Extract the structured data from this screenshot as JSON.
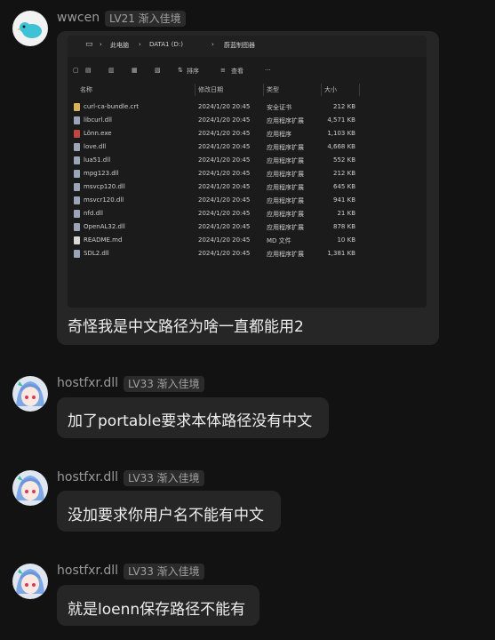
{
  "messages": [
    {
      "user": "wwcen",
      "level": "LV21 渐入佳境",
      "explorer": {
        "breadcrumb": [
          "此电脑",
          "DATA1 (D:)",
          "蔚蓝制图器"
        ],
        "toolbar": {
          "sort": "排序",
          "view": "查看",
          "more": "···"
        },
        "columns": [
          "名称",
          "修改日期",
          "类型",
          "大小"
        ],
        "files": [
          {
            "name": "curl-ca-bundle.crt",
            "date": "2024/1/20 20:45",
            "type": "安全证书",
            "size": "212 KB",
            "icon": "certificate-icon"
          },
          {
            "name": "libcurl.dll",
            "date": "2024/1/20 20:45",
            "type": "应用程序扩展",
            "size": "4,571 KB",
            "icon": "dll-icon"
          },
          {
            "name": "Lönn.exe",
            "date": "2024/1/20 20:45",
            "type": "应用程序",
            "size": "1,103 KB",
            "icon": "app-icon"
          },
          {
            "name": "love.dll",
            "date": "2024/1/20 20:45",
            "type": "应用程序扩展",
            "size": "4,668 KB",
            "icon": "dll-icon"
          },
          {
            "name": "lua51.dll",
            "date": "2024/1/20 20:45",
            "type": "应用程序扩展",
            "size": "552 KB",
            "icon": "dll-icon"
          },
          {
            "name": "mpg123.dll",
            "date": "2024/1/20 20:45",
            "type": "应用程序扩展",
            "size": "212 KB",
            "icon": "dll-icon"
          },
          {
            "name": "msvcp120.dll",
            "date": "2024/1/20 20:45",
            "type": "应用程序扩展",
            "size": "645 KB",
            "icon": "dll-icon"
          },
          {
            "name": "msvcr120.dll",
            "date": "2024/1/20 20:45",
            "type": "应用程序扩展",
            "size": "941 KB",
            "icon": "dll-icon"
          },
          {
            "name": "nfd.dll",
            "date": "2024/1/20 20:45",
            "type": "应用程序扩展",
            "size": "21 KB",
            "icon": "dll-icon"
          },
          {
            "name": "OpenAL32.dll",
            "date": "2024/1/20 20:45",
            "type": "应用程序扩展",
            "size": "878 KB",
            "icon": "dll-icon"
          },
          {
            "name": "README.md",
            "date": "2024/1/20 20:45",
            "type": "MD 文件",
            "size": "10 KB",
            "icon": "text-file-icon"
          },
          {
            "name": "SDL2.dll",
            "date": "2024/1/20 20:45",
            "type": "应用程序扩展",
            "size": "1,381 KB",
            "icon": "dll-icon"
          }
        ]
      },
      "text": "奇怪我是中文路径为啥一直都能用2"
    },
    {
      "user": "hostfxr.dll",
      "level": "LV33 渐入佳境",
      "text": "加了portable要求本体路径没有中文"
    },
    {
      "user": "hostfxr.dll",
      "level": "LV33 渐入佳境",
      "text": "没加要求你用户名不能有中文"
    },
    {
      "user": "hostfxr.dll",
      "level": "LV33 渐入佳境",
      "text": "就是loenn保存路径不能有"
    }
  ]
}
